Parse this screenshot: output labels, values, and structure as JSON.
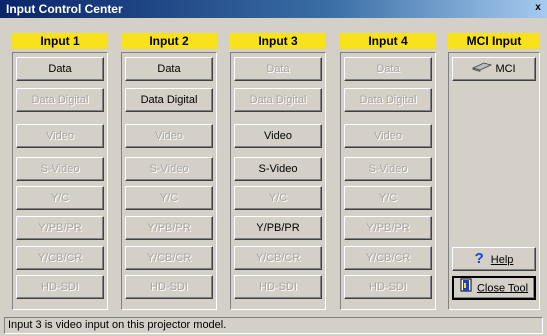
{
  "window": {
    "title": "Input Control Center",
    "close_glyph": "x"
  },
  "columns": [
    {
      "header": "Input 1",
      "buttons": [
        {
          "label": "Data",
          "enabled": true
        },
        {
          "label": "Data Digital",
          "enabled": false
        },
        {
          "label": "Video",
          "enabled": false
        },
        {
          "label": "S-Video",
          "enabled": false
        },
        {
          "label": "Y/C",
          "enabled": false
        },
        {
          "label": "Y/PB/PR",
          "enabled": false
        },
        {
          "label": "Y/CB/CR",
          "enabled": false
        },
        {
          "label": "HD-SDI",
          "enabled": false
        }
      ]
    },
    {
      "header": "Input 2",
      "buttons": [
        {
          "label": "Data",
          "enabled": true
        },
        {
          "label": "Data Digital",
          "enabled": true
        },
        {
          "label": "Video",
          "enabled": false
        },
        {
          "label": "S-Video",
          "enabled": false
        },
        {
          "label": "Y/C",
          "enabled": false
        },
        {
          "label": "Y/PB/PR",
          "enabled": false
        },
        {
          "label": "Y/CB/CR",
          "enabled": false
        },
        {
          "label": "HD-SDI",
          "enabled": false
        }
      ]
    },
    {
      "header": "Input 3",
      "buttons": [
        {
          "label": "Data",
          "enabled": false
        },
        {
          "label": "Data Digital",
          "enabled": false
        },
        {
          "label": "Video",
          "enabled": true
        },
        {
          "label": "S-Video",
          "enabled": true
        },
        {
          "label": "Y/C",
          "enabled": false
        },
        {
          "label": "Y/PB/PR",
          "enabled": true
        },
        {
          "label": "Y/CB/CR",
          "enabled": false
        },
        {
          "label": "HD-SDI",
          "enabled": false
        }
      ]
    },
    {
      "header": "Input 4",
      "buttons": [
        {
          "label": "Data",
          "enabled": false
        },
        {
          "label": "Data Digital",
          "enabled": false
        },
        {
          "label": "Video",
          "enabled": false
        },
        {
          "label": "S-Video",
          "enabled": false
        },
        {
          "label": "Y/C",
          "enabled": false
        },
        {
          "label": "Y/PB/PR",
          "enabled": false
        },
        {
          "label": "Y/CB/CR",
          "enabled": false
        },
        {
          "label": "HD-SDI",
          "enabled": false
        }
      ]
    }
  ],
  "mci": {
    "header": "MCI Input",
    "mci_button_label": "MCI",
    "help_button_label": "Help",
    "close_button_label": "Close Tool",
    "help_icon": "question-mark-icon",
    "close_icon": "door-exit-icon"
  },
  "status": {
    "text": "Input 3 is video input on this projector model."
  },
  "colors": {
    "header_bg": "#f7e21c",
    "title_bar": "#0a246a",
    "face": "#d4d0c8",
    "disabled_text": "#a8a5a0"
  }
}
